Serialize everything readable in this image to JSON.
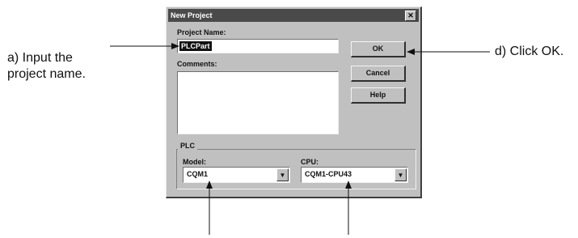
{
  "annotations": {
    "a_line1": "a) Input the",
    "a_line2": "project name.",
    "d": "d) Click OK."
  },
  "dialog": {
    "title": "New Project",
    "close_glyph": "✕",
    "project_name_label": "Project Name:",
    "project_name_value": "PLCPart",
    "comments_label": "Comments:",
    "comments_value": "",
    "buttons": {
      "ok": "OK",
      "cancel": "Cancel",
      "help": "Help"
    },
    "plc_group": {
      "title": "PLC",
      "model_label": "Model:",
      "model_value": "CQM1",
      "cpu_label": "CPU:",
      "cpu_value": "CQM1-CPU43",
      "dropdown_glyph": "▼"
    }
  }
}
